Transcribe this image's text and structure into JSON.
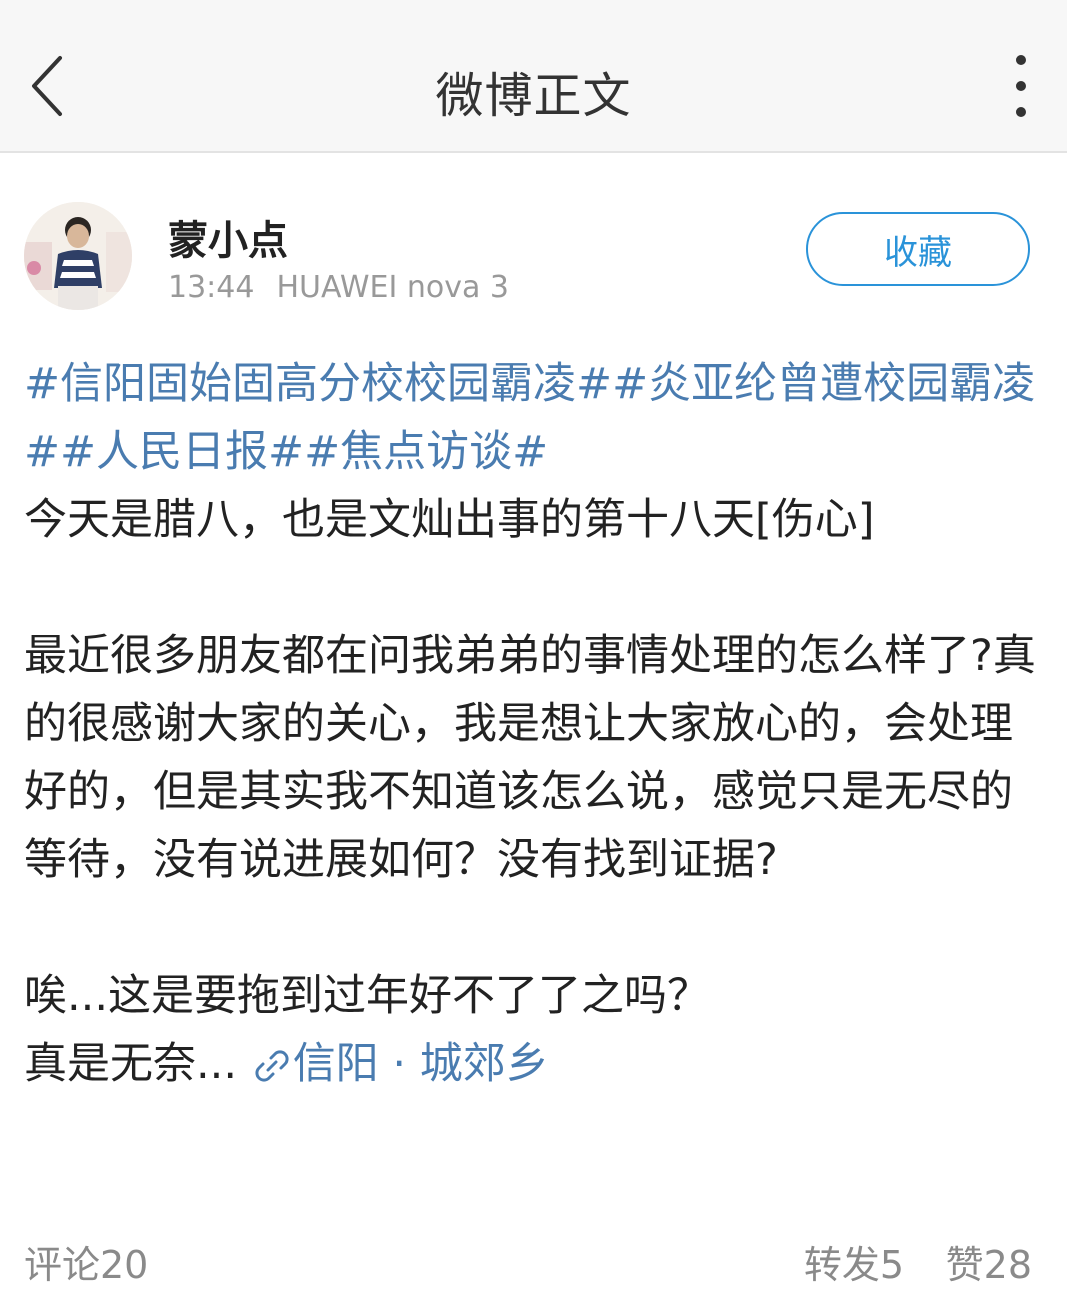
{
  "header": {
    "title": "微博正文",
    "back_icon": "chevron-left-icon",
    "more_icon": "more-vertical-icon"
  },
  "post": {
    "author": "蒙小点",
    "time": "13:44",
    "device": "HUAWEI nova 3",
    "favorite_label": "收藏",
    "topics": [
      "#信阳固始固高分校校园霸凌#",
      "#炎亚纶曾遭校园霸凌#",
      "#人民日报#",
      "#焦点访谈#"
    ],
    "line1": "今天是腊八，也是文灿出事的第十八天[伤心]",
    "para2": "最近很多朋友都在问我弟弟的事情处理的怎么样了?真的很感谢大家的关心，我是想让大家放心的，会处理好的，但是其实我不知道该怎么说，感觉只是无尽的等待，没有说进展如何？没有找到证据?",
    "line3": "唉...这是要拖到过年好不了了之吗？",
    "line4": "真是无奈...",
    "location": "信阳 · 城郊乡"
  },
  "footer": {
    "comments": "评论20",
    "reposts": "转发5",
    "likes": "赞28"
  },
  "colors": {
    "accent": "#2a93d9",
    "link": "#4a7cb0",
    "muted": "#999999"
  }
}
